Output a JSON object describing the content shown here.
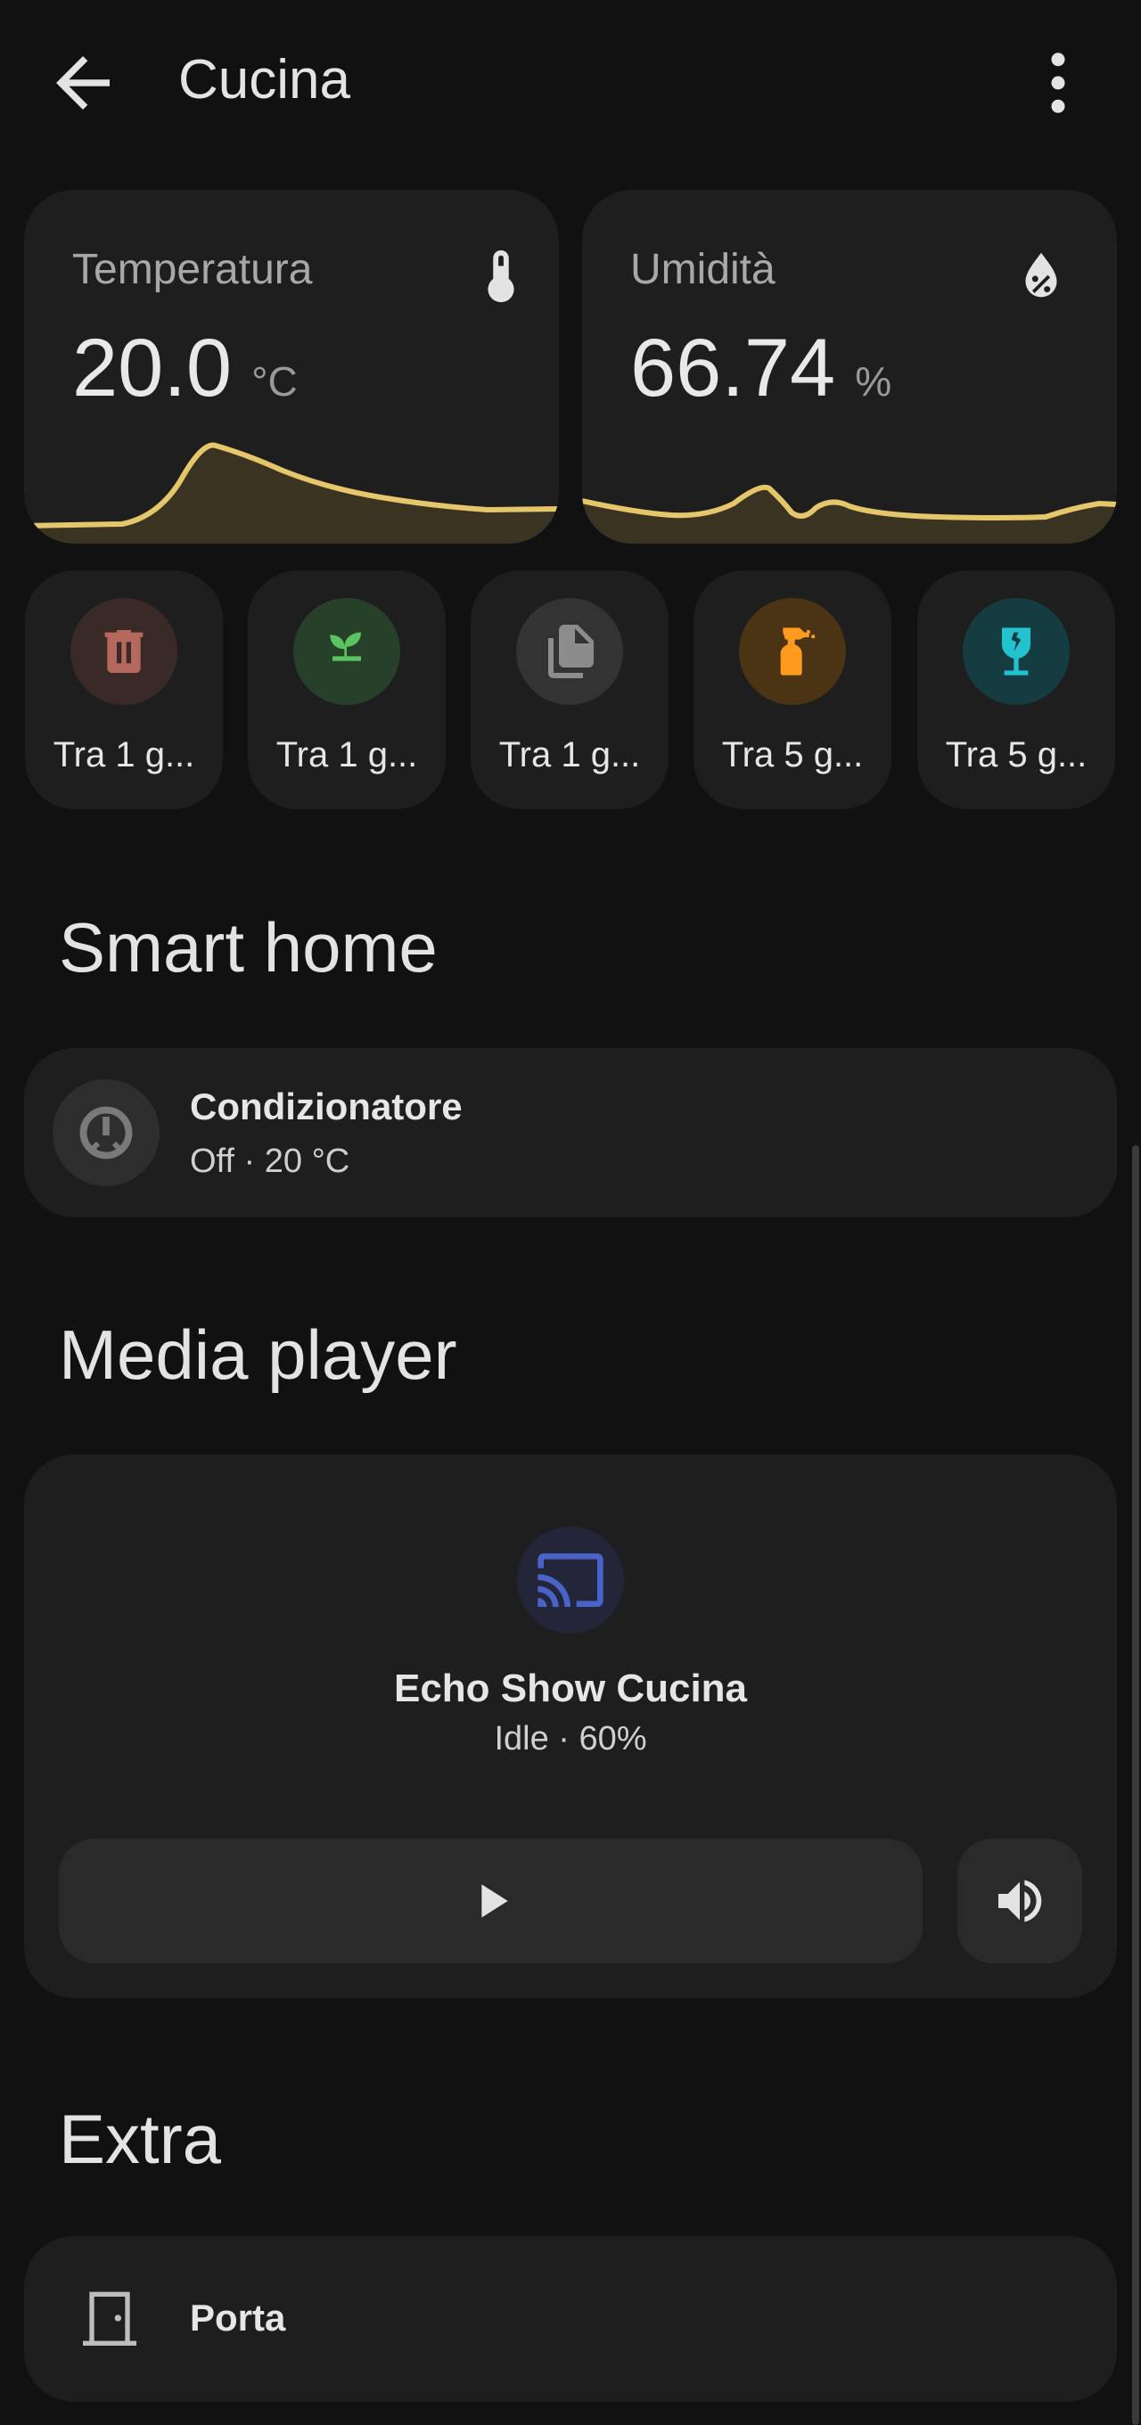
{
  "header": {
    "title": "Cucina",
    "back_icon": "arrow-left-icon",
    "menu_icon": "dots-vertical-icon"
  },
  "sensors": [
    {
      "title": "Temperatura",
      "value": "20.0",
      "unit": "°C",
      "icon": "thermometer-icon",
      "accent": "#e6c66a"
    },
    {
      "title": "Umidità",
      "value": "66.74",
      "unit": "%",
      "icon": "water-percent-icon",
      "accent": "#e6c66a"
    }
  ],
  "chips": [
    {
      "label": "Tra 1 g...",
      "icon": "trash-can-icon",
      "color": "#b5695c",
      "bg": "#3a2a27"
    },
    {
      "label": "Tra 1 g...",
      "icon": "sprout-icon",
      "color": "#5cc363",
      "bg": "#26402a"
    },
    {
      "label": "Tra 1 g...",
      "icon": "file-document-multiple-icon",
      "color": "#8c8c8c",
      "bg": "#333333"
    },
    {
      "label": "Tra 5 g...",
      "icon": "spray-bottle-icon",
      "color": "#ff9a1f",
      "bg": "#4a3414"
    },
    {
      "label": "Tra 5 g...",
      "icon": "glass-fragile-icon",
      "color": "#22c3cf",
      "bg": "#153c40"
    }
  ],
  "sections": {
    "smart_home": "Smart home",
    "media_player": "Media player",
    "extra": "Extra"
  },
  "climate": {
    "name": "Condizionatore",
    "state": "Off · 20 °C",
    "icon": "thermostat-off-icon"
  },
  "media": {
    "name": "Echo Show Cucina",
    "state": "Idle · 60%",
    "icon": "cast-icon",
    "accent": "#4a63c9",
    "play_icon": "play-icon",
    "volume_icon": "volume-high-icon"
  },
  "door": {
    "name": "Porta",
    "icon": "door-icon"
  }
}
